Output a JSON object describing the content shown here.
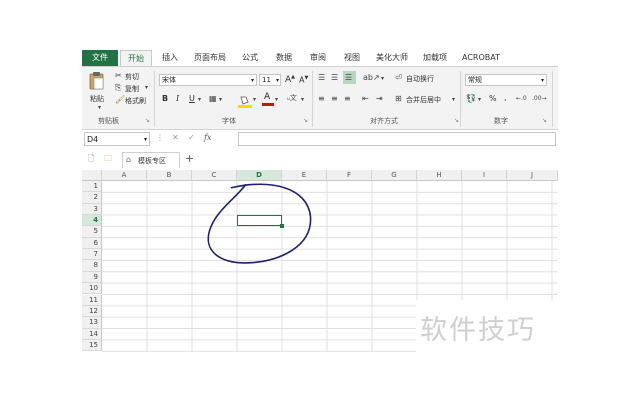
{
  "ribbon_tabs": [
    "文件",
    "开始",
    "插入",
    "页面布局",
    "公式",
    "数据",
    "审阅",
    "视图",
    "美化大师",
    "加载项",
    "ACROBAT"
  ],
  "clipboard": {
    "paste": "粘贴",
    "cut": "剪切",
    "copy": "复制",
    "format_painter": "格式刷",
    "label": "剪贴板"
  },
  "font": {
    "name": "宋体",
    "size": "11",
    "grow": "A",
    "shrink": "A",
    "bold": "B",
    "italic": "I",
    "underline": "U",
    "label": "字体",
    "font_color_glyph": "A"
  },
  "alignment": {
    "wrap_text": "自动换行",
    "merge_center": "合并后居中",
    "label": "对齐方式"
  },
  "number": {
    "format": "常规",
    "percent": "%",
    "comma": ",",
    "label": "数字"
  },
  "formula_bar": {
    "name_box": "D4",
    "fx": "fx",
    "value": ""
  },
  "quick_bar": {
    "template_tab": "模板专区",
    "add": "+"
  },
  "grid": {
    "columns": [
      "A",
      "B",
      "C",
      "D",
      "E",
      "F",
      "G",
      "H",
      "I",
      "J"
    ],
    "rows": [
      "1",
      "2",
      "3",
      "4",
      "5",
      "6",
      "7",
      "8",
      "9",
      "10",
      "11",
      "12",
      "13",
      "14",
      "15"
    ],
    "selected_cell": "D4",
    "annotation_color": "#1f1f6e"
  },
  "watermark": "软件技巧",
  "colors": {
    "accent": "#217346",
    "ribbon_bg": "#f3f3f3",
    "gridline": "#e0e0e0",
    "fill_yellow": "#ffd800",
    "font_red": "#d11010"
  }
}
